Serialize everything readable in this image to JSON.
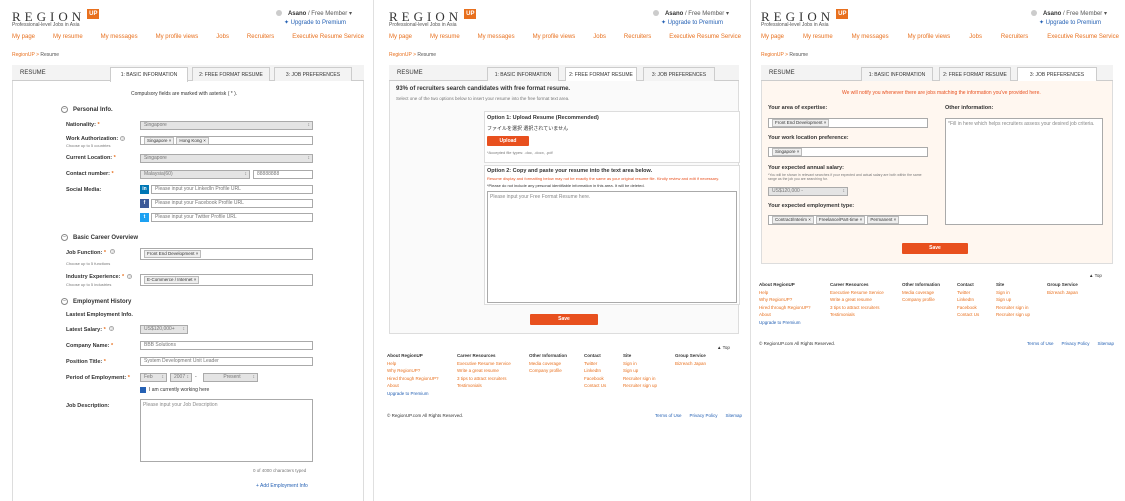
{
  "header": {
    "logo": "REGION",
    "logo_badge": "UP",
    "tagline": "Professional-level Jobs in Asia",
    "user_name": "Asano",
    "member_status": "Free Member",
    "premium_link": "Upgrade to Premium"
  },
  "nav": [
    "My page",
    "My resume",
    "My messages",
    "My profile views",
    "Jobs",
    "Recruiters",
    "Executive Resume Service"
  ],
  "breadcrumb": {
    "home": "RegionUP",
    "current": "Resume"
  },
  "tabs": {
    "label": "RESUME",
    "items": [
      "1: BASIC INFORMATION",
      "2: FREE FORMAT RESUME",
      "3: JOB PREFERENCES"
    ]
  },
  "basic": {
    "compulsory": "Compulsory fields are marked with asterisk ( * ).",
    "personal_title": "Personal Info.",
    "nationality_label": "Nationality:",
    "nationality_value": "Singapore",
    "work_auth_label": "Work Authorization:",
    "work_auth_sub": "Choose up to 5 countries",
    "work_auth_tags": [
      "Singapore",
      "Hong Kong"
    ],
    "location_label": "Current Location:",
    "location_value": "Singapore",
    "contact_label": "Contact number:",
    "contact_code": "Malaysia(60)",
    "contact_number": "88888888",
    "social_label": "Social Media:",
    "linkedin_ph": "Please input your LinkedIn Profile URL",
    "facebook_ph": "Please input your Facebook Profile URL",
    "twitter_ph": "Please input your Twitter Profile URL",
    "career_title": "Basic Career Overview",
    "job_function_label": "Job Function:",
    "job_function_sub": "Choose up to 5 functions",
    "job_function_tag": "Front End Development",
    "industry_label": "Industry Experience:",
    "industry_sub": "Choose up to 5 industries",
    "industry_tag": "E-Commerce / Internet",
    "employment_title": "Employment History",
    "latest_title": "Lastest Employment Info.",
    "salary_label": "Latest Salary:",
    "salary_value": "US$120,000+",
    "company_label": "Company Name:",
    "company_value": "BBB Solutions",
    "position_label": "Position Title:",
    "position_value": "System Development Unit Leader",
    "period_label": "Period of Employment:",
    "period_month": "Feb",
    "period_year": "2007",
    "period_dash": "-",
    "period_present": "Present",
    "currently_working": "I am currently working here",
    "job_desc_label": "Job Description:",
    "job_desc_ph": "Please input your Job Description",
    "char_count": "0 of 4000 characters typed",
    "add_employment": "+ Add Employment Info"
  },
  "free_format": {
    "headline": "93% of recruiters search candidates with free format resume.",
    "instruction": "Select one of the two options below to insert your resume into the free format text area.",
    "opt1_title": "Option 1: Upload Resume (Recommended)",
    "opt1_file": "ファイルを選択   選択されていません",
    "upload_button": "Upload",
    "accepted": "*Accepted file types: .doc, .docx, .pdf",
    "opt2_title": "Option 2: Copy and paste your resume into the text area below.",
    "opt2_note1": "Resume display and formatting below may not be exactly the same as your original resume file. Kindly review and edit if necessary.",
    "opt2_note2": "*Please do not include any personal identifiable information in this area. It will be deleted.",
    "textarea_ph": "Please input your Free Format Resume here.",
    "save_button": "Save"
  },
  "prefs": {
    "notice": "We will notify you whenever there are jobs matching the information you've provided here.",
    "expertise_label": "Your area of expertise:",
    "expertise_tag": "Front End Development",
    "location_label": "Your work location preference:",
    "location_tag": "Singapore",
    "salary_label": "Your expected annual salary:",
    "salary_note": "*You will be shown in relevant searches if your expected and actual salary are both within the same range as the job you are searching for.",
    "salary_value": "US$120,000 -",
    "employment_label": "Your expected employment type:",
    "employment_tags": [
      "Contract/Interim",
      "Freelance/Part-time",
      "Permanent"
    ],
    "other_label": "Other information:",
    "other_text": "*Fill in here which helps recruiters assess your desired job criteria.",
    "save_button": "Save"
  },
  "footer": {
    "top_link": "Top",
    "columns": [
      {
        "heading": "About RegionUP",
        "links": [
          "Help",
          "Why RegionUP?",
          "Hired through RegionUP?",
          "About"
        ]
      },
      {
        "heading": "Career Resources",
        "links": [
          "Executive Resume Service",
          "Write a great resume",
          "3 tips to attract recruiters",
          "Testimonials"
        ]
      },
      {
        "heading": "Other Information",
        "links": [
          "Media coverage",
          "Company profile"
        ]
      },
      {
        "heading": "Contact",
        "links": [
          "Twitter",
          "LinkedIn",
          "Facebook",
          "Contact Us"
        ]
      },
      {
        "heading": "Site",
        "links": [
          "Sign in",
          "Sign up",
          "Recruiter sign in",
          "Recruiter sign up"
        ]
      },
      {
        "heading": "Group Service",
        "links": [
          "Bizreach Japan"
        ]
      }
    ],
    "upgrade": "Upgrade to Premium",
    "copyright": "© RegionUP.com All Rights Reserved.",
    "terms": "Terms of Use",
    "privacy": "Privacy Policy",
    "sitemap": "Sitemap"
  },
  "colors": {
    "accent": "#e8701e",
    "button": "#e8501e",
    "link": "#2561b4"
  }
}
